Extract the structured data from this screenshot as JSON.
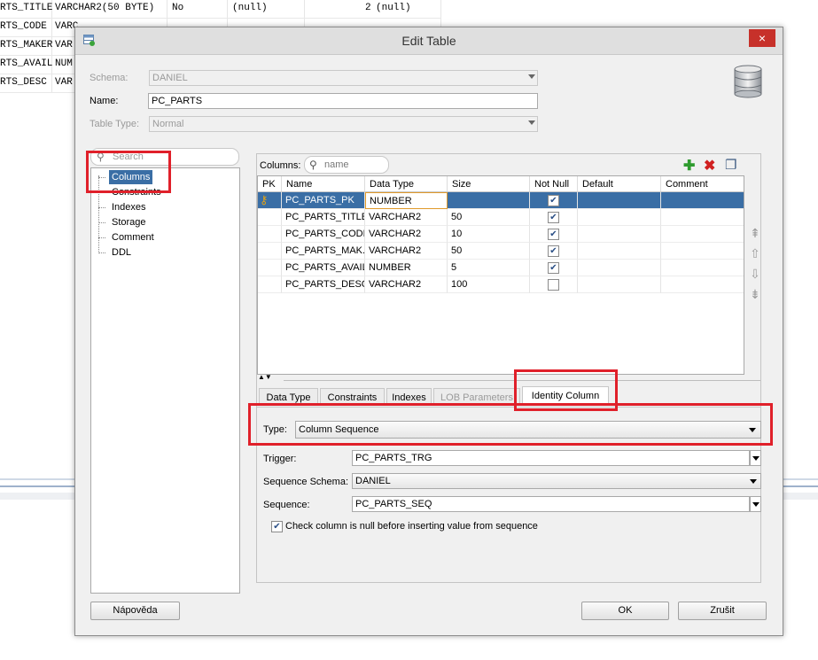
{
  "background_table": {
    "rows": [
      {
        "name": "RTS_TITLE",
        "type": "VARCHAR2(50 BYTE)",
        "nullable": "No",
        "default": "(null)",
        "id": "2",
        "comment": "(null)"
      },
      {
        "name": "RTS_CODE",
        "type": "VARC",
        "nullable": "",
        "default": "",
        "id": "",
        "comment": ""
      },
      {
        "name": "RTS_MAKER",
        "type": "VAR",
        "nullable": "",
        "default": "",
        "id": "",
        "comment": ""
      },
      {
        "name": "RTS_AVAIL",
        "type": "NUM",
        "nullable": "",
        "default": "",
        "id": "",
        "comment": ""
      },
      {
        "name": "RTS_DESC",
        "type": "VAR",
        "nullable": "",
        "default": "",
        "id": "",
        "comment": ""
      }
    ]
  },
  "dialog": {
    "title": "Edit Table",
    "close_glyph": "×",
    "schema_label": "Schema:",
    "schema_value": "DANIEL",
    "name_label": "Name:",
    "name_value": "PC_PARTS",
    "table_type_label": "Table Type:",
    "table_type_value": "Normal"
  },
  "nav": {
    "search_placeholder": "Search",
    "items": [
      "Columns",
      "Constraints",
      "Indexes",
      "Storage",
      "Comment",
      "DDL"
    ],
    "selected": "Columns"
  },
  "columns_toolbar": {
    "label": "Columns:",
    "filter_placeholder": "name",
    "add_glyph": "✚",
    "remove_glyph": "✖",
    "copy_glyph": "❐"
  },
  "columns_table": {
    "headers": [
      "PK",
      "Name",
      "Data Type",
      "Size",
      "Not Null",
      "Default",
      "Comment"
    ],
    "rows": [
      {
        "pk": true,
        "name": "PC_PARTS_PK",
        "type": "NUMBER",
        "size": "",
        "not_null": true,
        "default": "",
        "comment": ""
      },
      {
        "pk": false,
        "name": "PC_PARTS_TITLE",
        "type": "VARCHAR2",
        "size": "50",
        "not_null": true,
        "default": "",
        "comment": ""
      },
      {
        "pk": false,
        "name": "PC_PARTS_CODE",
        "type": "VARCHAR2",
        "size": "10",
        "not_null": true,
        "default": "",
        "comment": ""
      },
      {
        "pk": false,
        "name": "PC_PARTS_MAK...",
        "type": "VARCHAR2",
        "size": "50",
        "not_null": true,
        "default": "",
        "comment": ""
      },
      {
        "pk": false,
        "name": "PC_PARTS_AVAIL",
        "type": "NUMBER",
        "size": "5",
        "not_null": true,
        "default": "",
        "comment": ""
      },
      {
        "pk": false,
        "name": "PC_PARTS_DESC",
        "type": "VARCHAR2",
        "size": "100",
        "not_null": false,
        "default": "",
        "comment": ""
      }
    ],
    "selected_row": 0
  },
  "detail_tabs": {
    "tabs": [
      "Data Type",
      "Constraints",
      "Indexes",
      "LOB Parameters",
      "Identity Column"
    ],
    "active": "Identity Column",
    "disabled": [
      "LOB Parameters"
    ]
  },
  "identity": {
    "type_label": "Type:",
    "type_value": "Column Sequence",
    "trigger_label": "Trigger:",
    "trigger_value": "PC_PARTS_TRG",
    "seq_schema_label": "Sequence Schema:",
    "seq_schema_value": "DANIEL",
    "sequence_label": "Sequence:",
    "sequence_value": "PC_PARTS_SEQ",
    "check_label": "Check column is null before inserting value from sequence",
    "check_checked": true
  },
  "footer": {
    "help_label": "Nápověda",
    "ok_label": "OK",
    "cancel_label": "Zrušit"
  },
  "colors": {
    "selection": "#3a6ea5",
    "highlight_box": "#e0202a",
    "add_icon": "#2e9b2e",
    "remove_icon": "#d02020"
  }
}
